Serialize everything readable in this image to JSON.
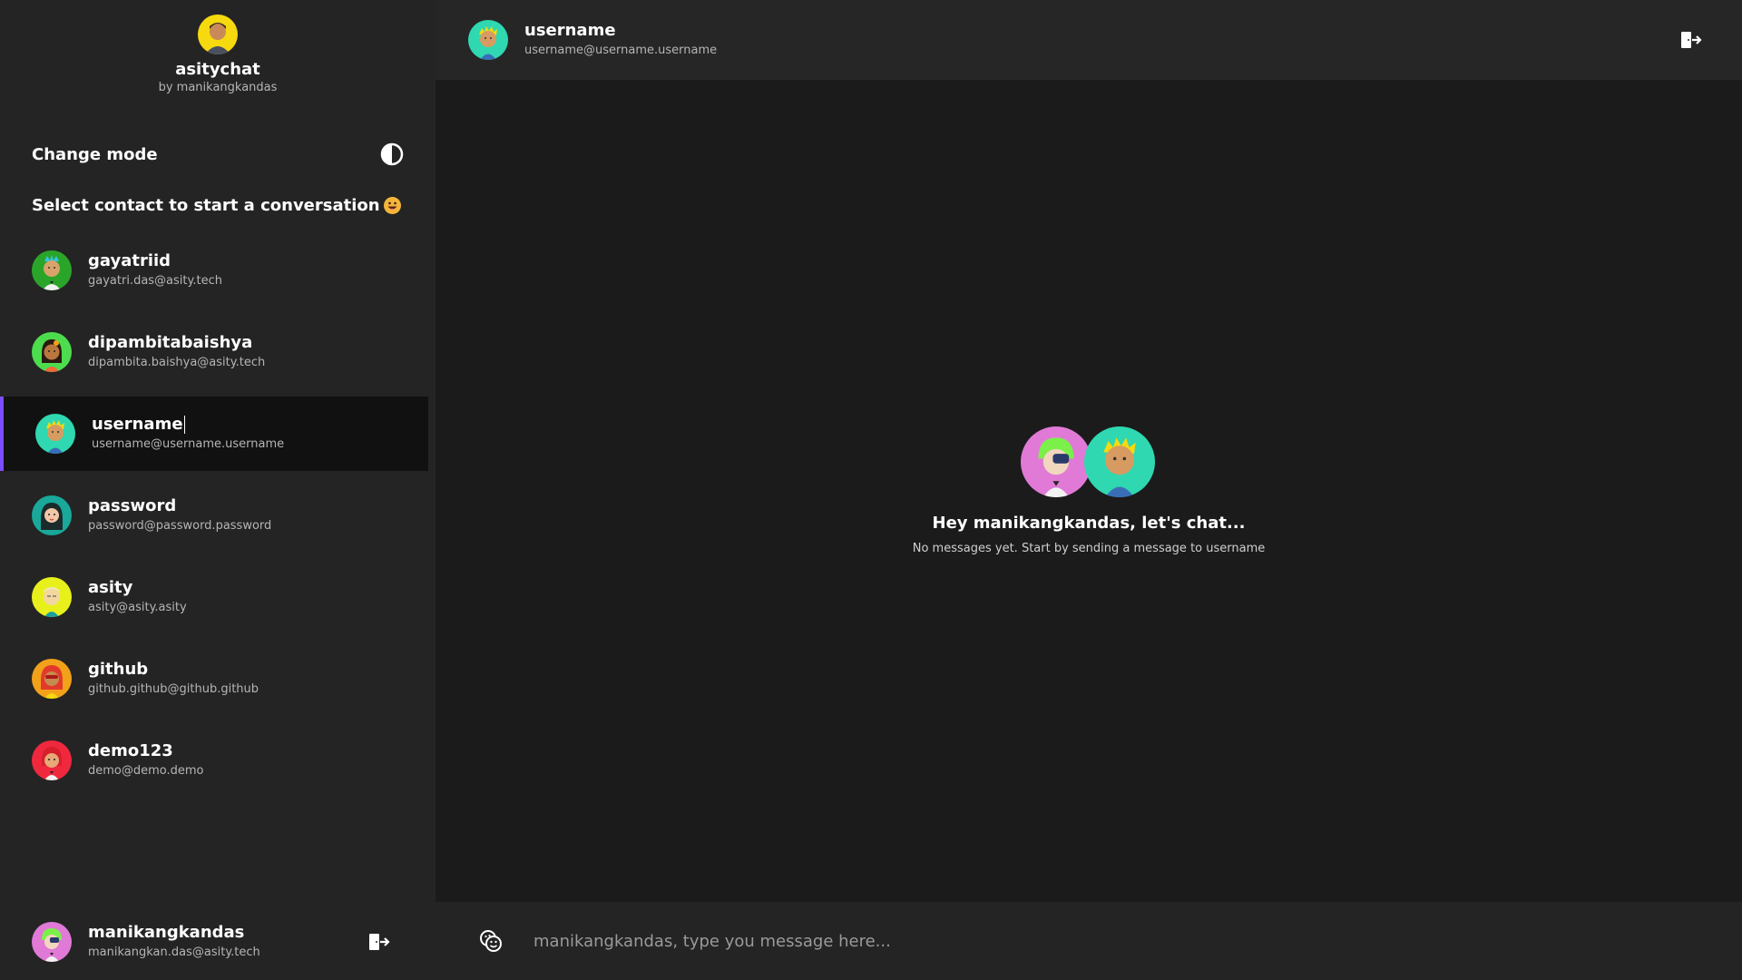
{
  "brand": {
    "name": "asitychat",
    "by": "by manikangkandas",
    "logo_icon": "user-avatar-icon"
  },
  "sidebar": {
    "change_mode_label": "Change mode",
    "mode_icon": "contrast-icon",
    "prompt": "Select contact to start a conversation",
    "contacts": [
      {
        "name": "gayatriid",
        "email": "gayatri.das@asity.tech",
        "color": "#2aa52a"
      },
      {
        "name": "dipambitabaishya",
        "email": "dipambita.baishya@asity.tech",
        "color": "#4ddc4d"
      },
      {
        "name": "username",
        "email": "username@username.username",
        "color": "#2fd8b0",
        "active": true
      },
      {
        "name": "password",
        "email": "password@password.password",
        "color": "#19a89a"
      },
      {
        "name": "asity",
        "email": "asity@asity.asity",
        "color": "#e8f01c"
      },
      {
        "name": "github",
        "email": "github.github@github.github",
        "color": "#f2a11a"
      },
      {
        "name": "demo123",
        "email": "demo@demo.demo",
        "color": "#f0283e"
      }
    ],
    "me": {
      "name": "manikangkandas",
      "email": "manikangkan.das@asity.tech",
      "color": "#e07ad6"
    }
  },
  "header": {
    "name": "username",
    "email": "username@username.username"
  },
  "chat": {
    "greeting": "Hey manikangkandas, let's chat...",
    "empty_text": "No messages yet. Start by sending a message to username"
  },
  "composer": {
    "placeholder": "manikangkandas, type you message here...",
    "value": ""
  },
  "colors": {
    "accent": "#7c4dff",
    "sidebar_bg": "#242424",
    "chat_bg": "#1b1b1b"
  }
}
